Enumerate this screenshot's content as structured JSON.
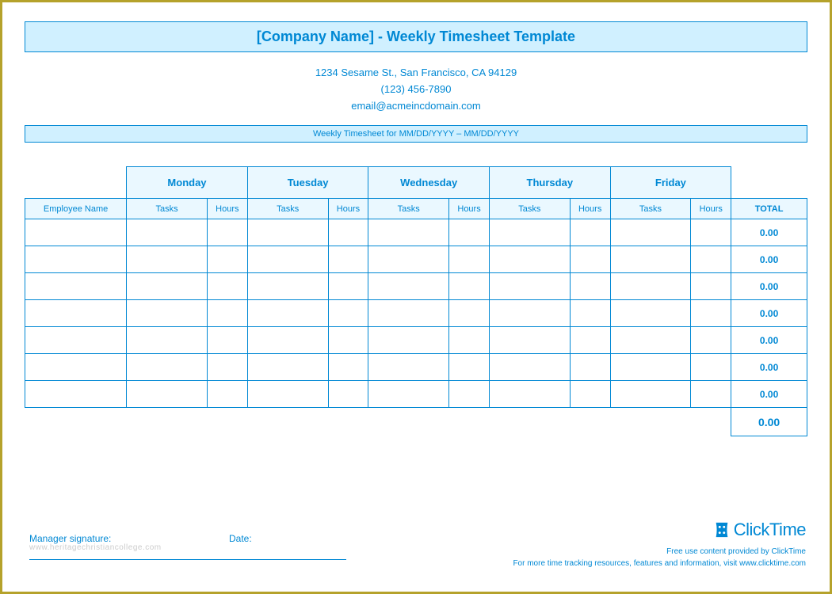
{
  "title": "[Company Name] - Weekly Timesheet Template",
  "company": {
    "address": "1234 Sesame St.,  San Francisco, CA 94129",
    "phone": "(123) 456-7890",
    "email": "email@acmeincdomain.com"
  },
  "period_label": "Weekly Timesheet for MM/DD/YYYY – MM/DD/YYYY",
  "headers": {
    "employee": "Employee Name",
    "days": [
      "Monday",
      "Tuesday",
      "Wednesday",
      "Thursday",
      "Friday"
    ],
    "tasks": "Tasks",
    "hours": "Hours",
    "total": "TOTAL"
  },
  "rows": [
    {
      "total": "0.00"
    },
    {
      "total": "0.00"
    },
    {
      "total": "0.00"
    },
    {
      "total": "0.00"
    },
    {
      "total": "0.00"
    },
    {
      "total": "0.00"
    },
    {
      "total": "0.00"
    }
  ],
  "grand_total": "0.00",
  "signature": {
    "manager": "Manager signature:",
    "date": "Date:"
  },
  "watermark": "www.heritagechristiancollege.com",
  "brand": {
    "name": "ClickTime",
    "line1": "Free use content provided by ClickTime",
    "line2": "For more time tracking resources, features and information, visit www.clicktime.com"
  }
}
